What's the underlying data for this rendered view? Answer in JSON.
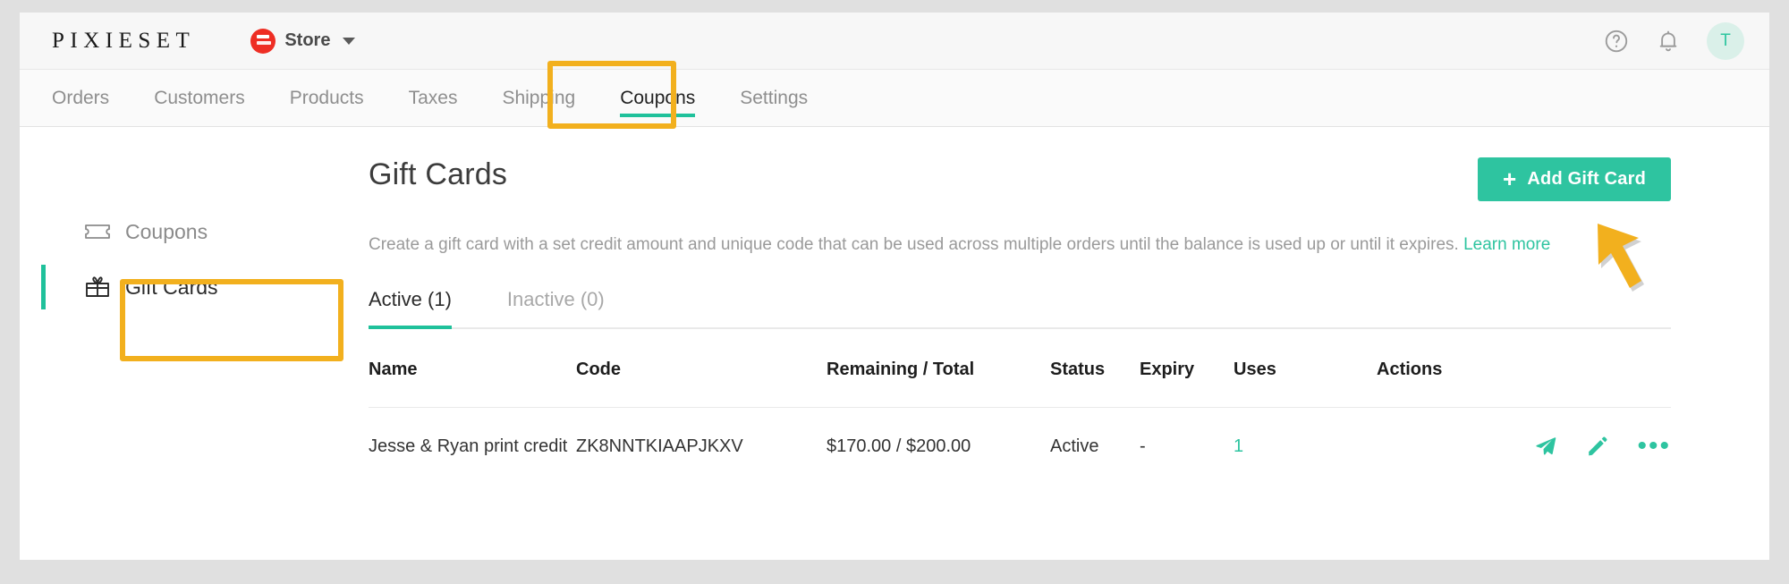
{
  "brand": "PIXIESET",
  "store_switcher": {
    "label": "Store",
    "logo_icon": "pixieset-store-logo",
    "chevron_icon": "chevron-down-icon"
  },
  "topbar_right": {
    "help_icon": "help-circle-icon",
    "bell_icon": "notification-bell-icon",
    "avatar_initial": "T"
  },
  "nav_tabs": [
    {
      "label": "Orders",
      "active": false
    },
    {
      "label": "Customers",
      "active": false
    },
    {
      "label": "Products",
      "active": false
    },
    {
      "label": "Taxes",
      "active": false
    },
    {
      "label": "Shipping",
      "active": false
    },
    {
      "label": "Coupons",
      "active": true
    },
    {
      "label": "Settings",
      "active": false
    }
  ],
  "sidebar": {
    "items": [
      {
        "label": "Coupons",
        "icon": "ticket-icon",
        "selected": false
      },
      {
        "label": "Gift Cards",
        "icon": "gift-card-icon",
        "selected": true
      }
    ]
  },
  "main": {
    "title": "Gift Cards",
    "add_button": {
      "label": "Add Gift Card",
      "plus": "+"
    },
    "description": "Create a gift card with a set credit amount and unique code that can be used across multiple orders until the balance is used up or until it expires.",
    "learn_more": "Learn more",
    "subtabs": [
      {
        "label": "Active (1)",
        "active": true
      },
      {
        "label": "Inactive (0)",
        "active": false
      }
    ],
    "table": {
      "headers": {
        "name": "Name",
        "code": "Code",
        "remaining_total": "Remaining / Total",
        "status": "Status",
        "expiry": "Expiry",
        "uses": "Uses",
        "actions": "Actions"
      },
      "rows": [
        {
          "name": "Jesse & Ryan print credit",
          "code": "ZK8NNTKIAAPJKXV",
          "remaining_total": "$170.00 / $200.00",
          "status": "Active",
          "expiry": "-",
          "uses": "1",
          "actions": [
            "send-icon",
            "edit-pencil-icon",
            "more-options-icon"
          ]
        }
      ]
    }
  },
  "annotations": {
    "highlight_color": "#f2b01e",
    "arrow_icon": "pointer-arrow-annotation",
    "boxes": [
      "coupons-tab-highlight",
      "gift-cards-sidebar-highlight"
    ]
  },
  "colors": {
    "accent_teal": "#2ec4a0",
    "status_green": "#4a9c31",
    "logo_red": "#ee2e24",
    "annotation_orange": "#f2b01e"
  }
}
